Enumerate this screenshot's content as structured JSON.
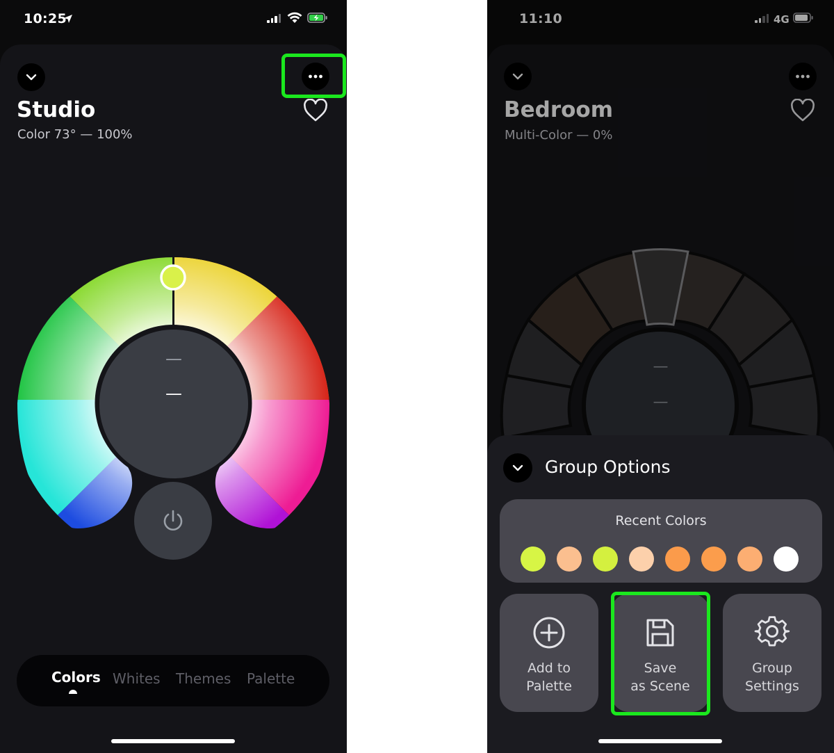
{
  "left": {
    "status": {
      "time": "10:25"
    },
    "room": {
      "title": "Studio",
      "subtitle": "Color 73° — 100%"
    },
    "wheel": {
      "center_top": "—",
      "center_bottom": "—"
    },
    "tabs": [
      {
        "label": "Colors",
        "active": true
      },
      {
        "label": "Whites",
        "active": false
      },
      {
        "label": "Themes",
        "active": false
      },
      {
        "label": "Palette",
        "active": false
      }
    ],
    "selected_color": "#d9f14a"
  },
  "right": {
    "status": {
      "time": "11:10",
      "network": "4G"
    },
    "room": {
      "title": "Bedroom",
      "subtitle": "Multi-Color — 0%"
    },
    "wheel": {
      "center_top": "—",
      "center_bottom": "—"
    },
    "options": {
      "title": "Group Options",
      "recent_colors_label": "Recent Colors",
      "recent_colors": [
        "#d7f545",
        "#fbbf8f",
        "#d4f03f",
        "#fcd0ab",
        "#fb9b4b",
        "#fb9d4c",
        "#fcae72",
        "#ffffff"
      ],
      "actions": [
        {
          "label_line1": "Add to",
          "label_line2": "Palette",
          "icon": "plus-circle-icon"
        },
        {
          "label_line1": "Save",
          "label_line2": "as Scene",
          "icon": "floppy-disk-icon"
        },
        {
          "label_line1": "Group",
          "label_line2": "Settings",
          "icon": "gear-icon"
        }
      ]
    }
  },
  "colors": {
    "highlight": "#1be81e",
    "sheet_bg": "#141418",
    "card_bg": "#48474f"
  }
}
